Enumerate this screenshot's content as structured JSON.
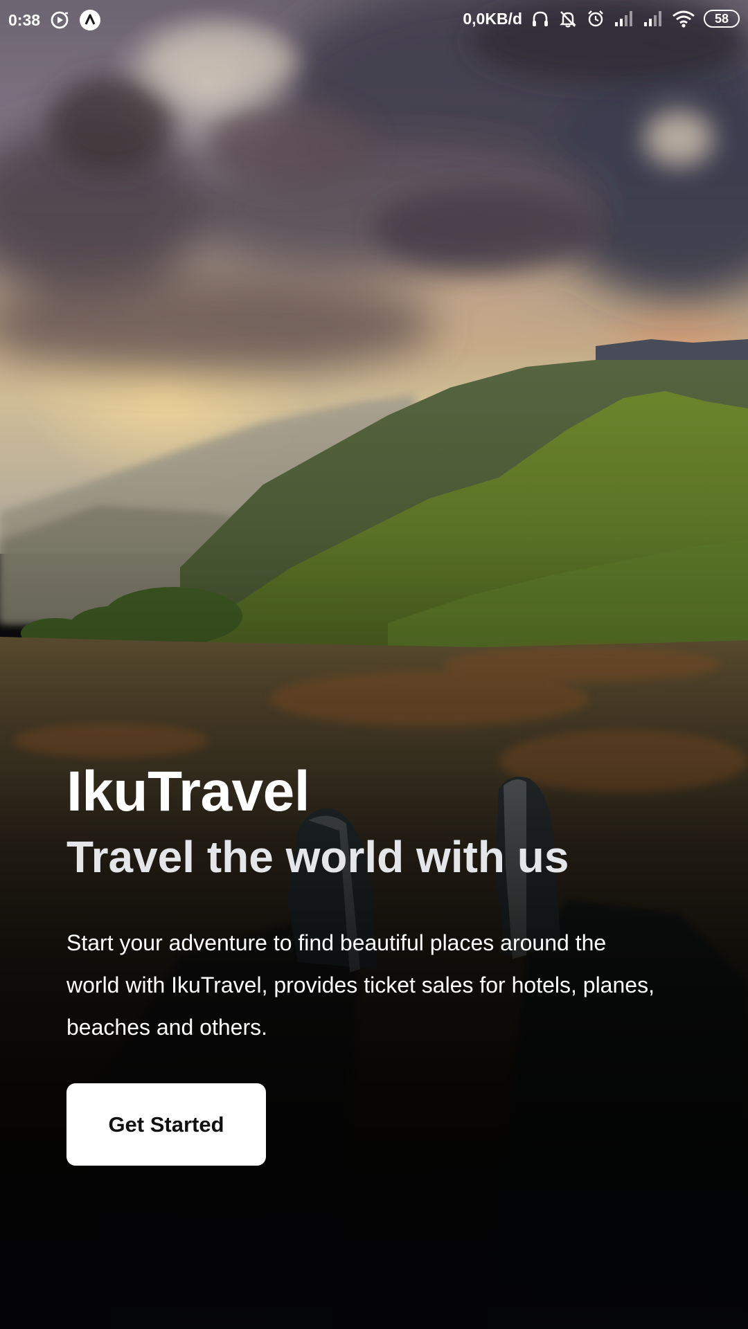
{
  "status_bar": {
    "time": "0:38",
    "left_icons": [
      "media-play-icon",
      "app-a-icon"
    ],
    "network_speed": "0,0KB/d",
    "right_icons": [
      "headphones-icon",
      "notifications-off-icon",
      "alarm-icon",
      "signal-icon",
      "signal-icon",
      "wifi-icon"
    ],
    "battery_level": "58"
  },
  "hero": {
    "app_name": "IkuTravel",
    "tagline": "Travel the world with us",
    "description": "Start your adventure to find beautiful places around the world with IkuTravel, provides ticket sales for hotels, planes, beaches and others.",
    "cta_label": "Get Started"
  },
  "background": {
    "scene": "mountain-landscape-photo",
    "accent_sky": "#a79584",
    "accent_hills": "#5f7a2c",
    "overlay_bottom": "#03040a"
  }
}
